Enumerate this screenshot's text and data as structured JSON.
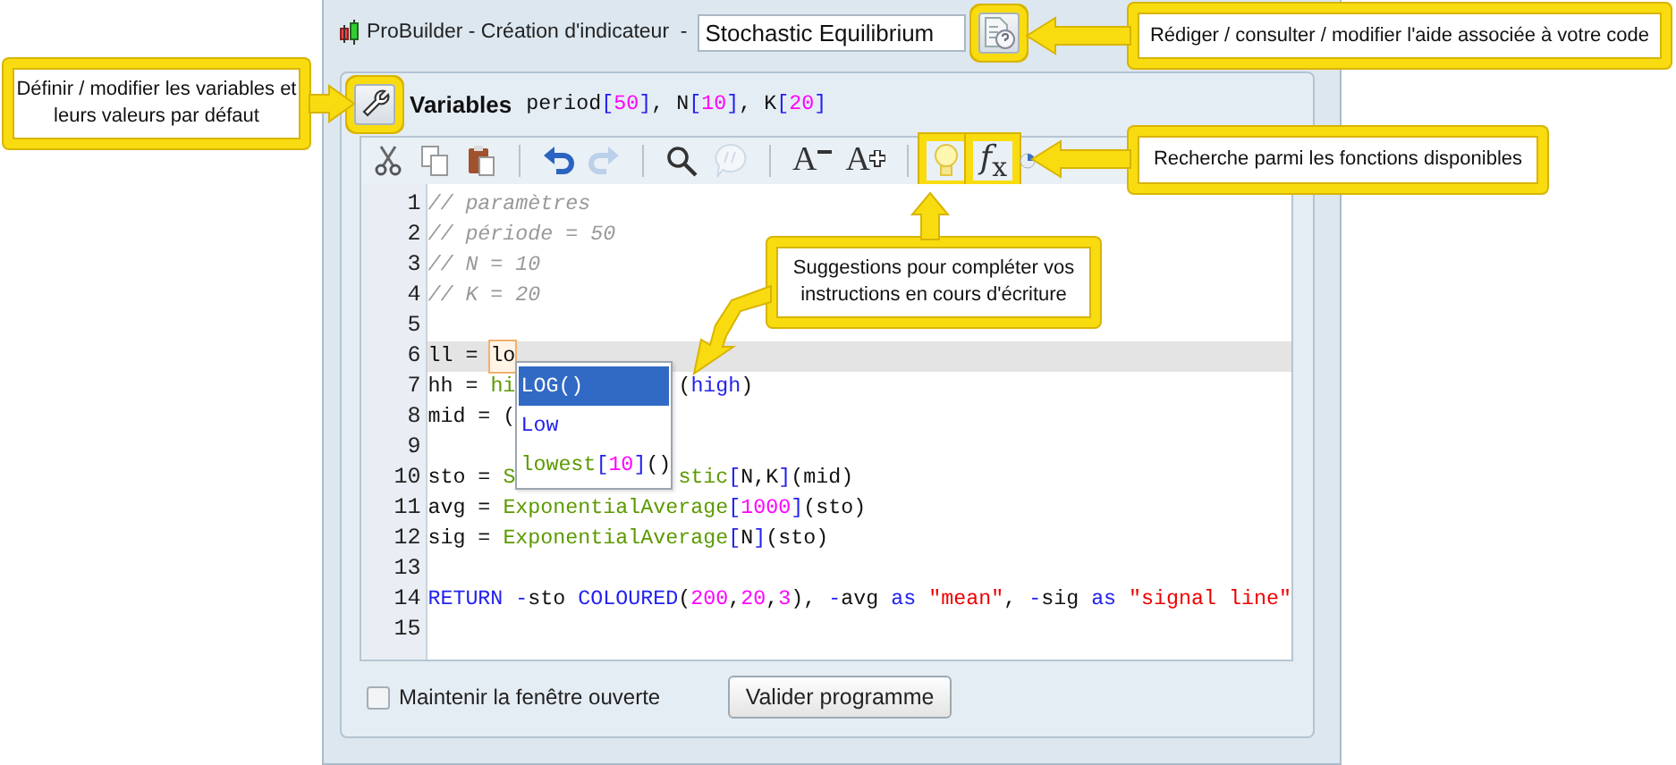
{
  "window": {
    "title": "ProBuilder - Création d'indicateur  -",
    "name_value": "Stochastic Equilibrium",
    "help_highlighted": true
  },
  "variables": {
    "label": "Variables",
    "edit_highlighted": true,
    "tokens": [
      {
        "kind": "plain",
        "text": "period"
      },
      {
        "kind": "bracket",
        "text": "["
      },
      {
        "kind": "num",
        "text": "50"
      },
      {
        "kind": "bracket",
        "text": "]"
      },
      {
        "kind": "plain",
        "text": ", N"
      },
      {
        "kind": "bracket",
        "text": "["
      },
      {
        "kind": "num",
        "text": "10"
      },
      {
        "kind": "bracket",
        "text": "]"
      },
      {
        "kind": "plain",
        "text": ", K"
      },
      {
        "kind": "bracket",
        "text": "["
      },
      {
        "kind": "num",
        "text": "20"
      },
      {
        "kind": "bracket",
        "text": "]"
      }
    ]
  },
  "toolbar": [
    {
      "kind": "cut",
      "disabled": false,
      "highlighted": false
    },
    {
      "kind": "copy",
      "disabled": false,
      "highlighted": false
    },
    {
      "kind": "paste",
      "disabled": false,
      "highlighted": false
    },
    {
      "kind": "separator"
    },
    {
      "kind": "undo",
      "disabled": false,
      "highlighted": false
    },
    {
      "kind": "redo",
      "disabled": true,
      "highlighted": false
    },
    {
      "kind": "separator"
    },
    {
      "kind": "search",
      "disabled": false,
      "highlighted": false
    },
    {
      "kind": "comment",
      "disabled": true,
      "highlighted": false
    },
    {
      "kind": "separator"
    },
    {
      "kind": "font-smaller",
      "label": "A",
      "disabled": false,
      "highlighted": false
    },
    {
      "kind": "font-larger",
      "label": "A",
      "disabled": false,
      "highlighted": false
    },
    {
      "kind": "separator"
    },
    {
      "kind": "suggest",
      "disabled": false,
      "highlighted": true
    },
    {
      "kind": "functions",
      "label": "*f*$_{x}$",
      "disabled": false,
      "highlighted": true
    },
    {
      "kind": "round",
      "disabled": false,
      "highlighted": false
    }
  ],
  "code": {
    "lines": [
      {
        "number": "1",
        "current": false,
        "tokens": [
          {
            "kind": "comment",
            "text": "// paramètres"
          }
        ]
      },
      {
        "number": "2",
        "current": false,
        "tokens": [
          {
            "kind": "comment",
            "text": "// période = 50"
          }
        ]
      },
      {
        "number": "3",
        "current": false,
        "tokens": [
          {
            "kind": "comment",
            "text": "// N = 10"
          }
        ]
      },
      {
        "number": "4",
        "current": false,
        "tokens": [
          {
            "kind": "comment",
            "text": "// K = 20"
          }
        ]
      },
      {
        "number": "5",
        "current": false
      },
      {
        "number": "6",
        "current": true,
        "tokens": [
          {
            "kind": "plain",
            "text": "ll = "
          },
          {
            "kind": "typed",
            "text": "lo"
          }
        ]
      },
      {
        "number": "7",
        "current": false,
        "tokens": [
          {
            "kind": "plain",
            "text": "hh = "
          },
          {
            "kind": "func",
            "text": "hi"
          }
        ],
        "after_popup": [
          {
            "kind": "plain",
            "text": "("
          },
          {
            "kind": "keyword",
            "text": "high"
          },
          {
            "kind": "plain",
            "text": ")"
          }
        ]
      },
      {
        "number": "8",
        "current": false,
        "tokens": [
          {
            "kind": "plain",
            "text": "mid = ("
          }
        ]
      },
      {
        "number": "9",
        "current": false
      },
      {
        "number": "10",
        "current": false,
        "tokens": [
          {
            "kind": "plain",
            "text": "sto = "
          },
          {
            "kind": "func",
            "text": "S"
          }
        ],
        "after_popup": [
          {
            "kind": "func",
            "text": "stic"
          },
          {
            "kind": "bracket",
            "text": "["
          },
          {
            "kind": "plain",
            "text": "N,K"
          },
          {
            "kind": "bracket",
            "text": "]"
          },
          {
            "kind": "plain",
            "text": "(mid)"
          }
        ]
      },
      {
        "number": "11",
        "current": false,
        "tokens": [
          {
            "kind": "plain",
            "text": "avg = "
          },
          {
            "kind": "func",
            "text": "ExponentialAverage"
          },
          {
            "kind": "bracket",
            "text": "["
          },
          {
            "kind": "num",
            "text": "1000"
          },
          {
            "kind": "bracket",
            "text": "]"
          },
          {
            "kind": "plain",
            "text": "(sto)"
          }
        ]
      },
      {
        "number": "12",
        "current": false,
        "tokens": [
          {
            "kind": "plain",
            "text": "sig = "
          },
          {
            "kind": "func",
            "text": "ExponentialAverage"
          },
          {
            "kind": "bracket",
            "text": "["
          },
          {
            "kind": "plain",
            "text": "N"
          },
          {
            "kind": "bracket",
            "text": "]"
          },
          {
            "kind": "plain",
            "text": "(sto)"
          }
        ]
      },
      {
        "number": "13",
        "current": false
      },
      {
        "number": "14",
        "current": false,
        "tokens": [
          {
            "kind": "keyword",
            "text": "RETURN -"
          },
          {
            "kind": "plain",
            "text": "sto "
          },
          {
            "kind": "keyword",
            "text": "COLOURED"
          },
          {
            "kind": "plain",
            "text": "("
          },
          {
            "kind": "num",
            "text": "200"
          },
          {
            "kind": "plain",
            "text": ","
          },
          {
            "kind": "num",
            "text": "20"
          },
          {
            "kind": "plain",
            "text": ","
          },
          {
            "kind": "num",
            "text": "3"
          },
          {
            "kind": "plain",
            "text": "), "
          },
          {
            "kind": "keyword",
            "text": "-"
          },
          {
            "kind": "plain",
            "text": "avg "
          },
          {
            "kind": "keyword",
            "text": "as"
          },
          {
            "kind": "string",
            "text": " \"mean\""
          },
          {
            "kind": "plain",
            "text": ", "
          },
          {
            "kind": "keyword",
            "text": "-"
          },
          {
            "kind": "plain",
            "text": "sig "
          },
          {
            "kind": "keyword",
            "text": "as"
          },
          {
            "kind": "string",
            "text": " \"signal line\""
          }
        ]
      },
      {
        "number": "15",
        "current": false
      }
    ]
  },
  "suggestions": [
    {
      "selected": true,
      "tokens": [
        {
          "kind": "keyword",
          "text": "LOG()"
        }
      ]
    },
    {
      "selected": false,
      "tokens": [
        {
          "kind": "keyword",
          "text": "Low"
        }
      ]
    },
    {
      "selected": false,
      "tokens": [
        {
          "kind": "func",
          "text": "lowest"
        },
        {
          "kind": "bracket",
          "text": "["
        },
        {
          "kind": "num",
          "text": "10"
        },
        {
          "kind": "bracket",
          "text": "]"
        },
        {
          "kind": "plain",
          "text": "()"
        }
      ]
    }
  ],
  "footer": {
    "keep_open": {
      "label": "Maintenir la fenêtre ouverte",
      "checked": false
    },
    "validate_button": "Valider programme"
  },
  "callouts": [
    {
      "kind": "help",
      "text": "Rédiger / consulter / modifier l'aide associée à votre code"
    },
    {
      "kind": "variables",
      "text": "Définir / modifier les variables et leurs valeurs par défaut"
    },
    {
      "kind": "functions",
      "text": "Recherche parmi les fonctions disponibles"
    },
    {
      "kind": "suggestions",
      "text": "Suggestions pour compléter vos instructions en cours d'écriture"
    }
  ]
}
